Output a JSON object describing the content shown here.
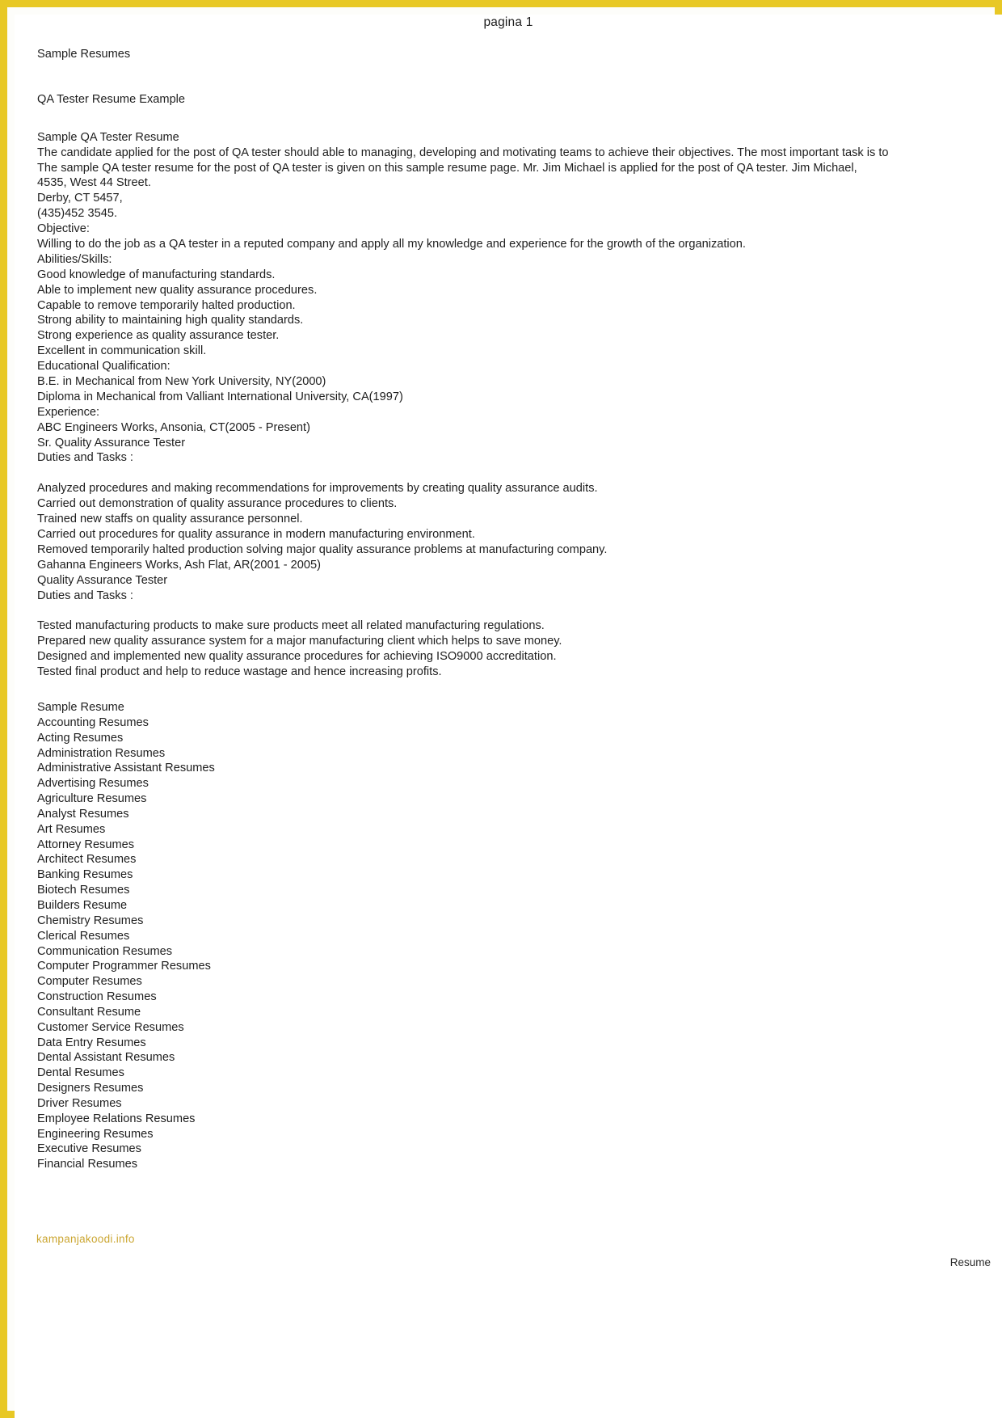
{
  "page": {
    "header": "pagina 1",
    "watermark": "kampanjakoodi.info",
    "footer_label": "Resume",
    "border_color": "#e8c825",
    "watermark_color": "#c9a227",
    "text_color": "#1e1e1e"
  },
  "document": {
    "site_title": "Sample Resumes",
    "example_title": "QA Tester Resume Example",
    "lines": [
      "Sample QA Tester Resume",
      "The candidate applied for the post of QA tester should able to managing, developing and motivating teams to achieve their objectives. The most important task is to",
      "The sample QA tester resume for the post of QA tester is given on this sample resume page. Mr. Jim Michael is applied for the post of QA tester. Jim Michael,",
      "4535, West 44 Street.",
      "Derby, CT 5457,",
      "(435)452 3545.",
      "Objective:",
      "Willing to do the job as a QA tester in a reputed company and apply all my knowledge and experience for the growth of the organization.",
      "Abilities/Skills:",
      "Good knowledge of manufacturing standards.",
      "Able to implement new quality assurance procedures.",
      "Capable to remove temporarily halted production.",
      "Strong ability to maintaining high quality standards.",
      "Strong experience as quality assurance tester.",
      "Excellent in communication skill.",
      "Educational Qualification:",
      "B.E. in Mechanical from New York University, NY(2000)",
      "Diploma in Mechanical from Valliant International University, CA(1997)",
      "Experience:",
      "ABC Engineers Works, Ansonia, CT(2005 - Present)",
      "Sr. Quality Assurance Tester",
      "Duties and Tasks :",
      "",
      "Analyzed procedures and making recommendations for improvements by creating quality assurance audits.",
      "Carried out demonstration of quality assurance procedures to clients.",
      "Trained new staffs on quality assurance personnel.",
      "Carried out procedures for quality assurance in modern manufacturing environment.",
      "Removed temporarily halted production solving major quality assurance problems at manufacturing company.",
      "Gahanna Engineers Works, Ash Flat, AR(2001 - 2005)",
      "Quality Assurance Tester",
      "Duties and Tasks :",
      "",
      "Tested manufacturing products to make sure products meet all related manufacturing regulations.",
      "Prepared new quality assurance system for a major manufacturing client which helps to save money.",
      "Designed and implemented new quality assurance procedures for achieving ISO9000 accreditation.",
      "Tested final product and help to reduce wastage and hence increasing profits."
    ]
  },
  "categories": [
    "Sample Resume",
    "Accounting Resumes",
    "Acting Resumes",
    "Administration Resumes",
    "Administrative Assistant Resumes",
    "Advertising Resumes",
    "Agriculture Resumes",
    "Analyst Resumes",
    "Art Resumes",
    "Attorney Resumes",
    "Architect Resumes",
    "Banking Resumes",
    "Biotech Resumes",
    "Builders Resume",
    "Chemistry Resumes",
    "Clerical Resumes",
    "Communication Resumes",
    "Computer Programmer Resumes",
    "Computer Resumes",
    "Construction Resumes",
    "Consultant Resume",
    "Customer Service Resumes",
    "Data Entry Resumes",
    "Dental Assistant Resumes",
    "Dental Resumes",
    "Designers Resumes",
    "Driver Resumes",
    "Employee Relations Resumes",
    "Engineering Resumes",
    "Executive Resumes",
    "Financial Resumes"
  ]
}
